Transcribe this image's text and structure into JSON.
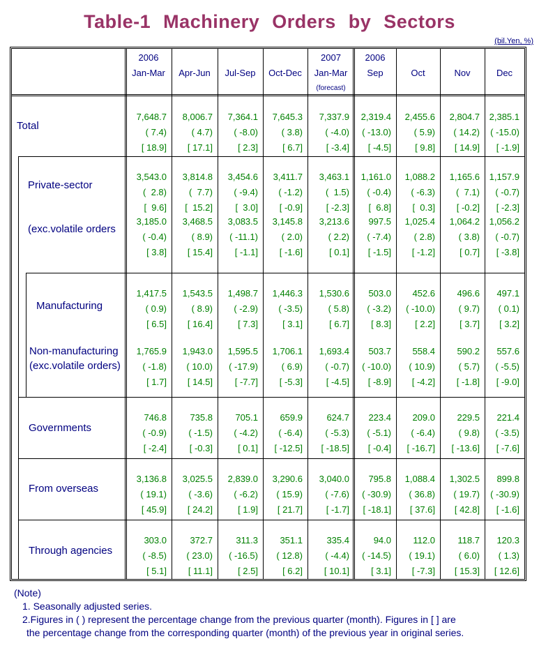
{
  "title": "Table-1  Machinery  Orders  by  Sectors",
  "unit": "(bil.Yen, %)",
  "columns": [
    {
      "line1": "2006",
      "line2": "Jan-Mar",
      "line3": ""
    },
    {
      "line1": "",
      "line2": "Apr-Jun",
      "line3": ""
    },
    {
      "line1": "",
      "line2": "Jul-Sep",
      "line3": ""
    },
    {
      "line1": "",
      "line2": "Oct-Dec",
      "line3": ""
    },
    {
      "line1": "2007",
      "line2": "Jan-Mar",
      "line3": "(forecast)"
    },
    {
      "line1": "2006",
      "line2": "Sep",
      "line3": ""
    },
    {
      "line1": "",
      "line2": "Oct",
      "line3": ""
    },
    {
      "line1": "",
      "line2": "Nov",
      "line3": ""
    },
    {
      "line1": "",
      "line2": "Dec",
      "line3": ""
    }
  ],
  "rows": [
    {
      "label": "Total",
      "values": [
        "7,648.7",
        "8,006.7",
        "7,364.1",
        "7,645.3",
        "7,337.9",
        "2,319.4",
        "2,455.6",
        "2,804.7",
        "2,385.1"
      ],
      "qoq": [
        "( 7.4)",
        "( 4.7)",
        "( -8.0)",
        "( 3.8)",
        "( -4.0)",
        "( -13.0)",
        "( 5.9)",
        "( 14.2)",
        "( -15.0)"
      ],
      "yoy": [
        "[ 18.9]",
        "[ 17.1]",
        "[ 2.3]",
        "[ 6.7]",
        "[ -3.4]",
        "[ -4.5]",
        "[ 9.8]",
        "[ 14.9]",
        "[ -1.9]"
      ]
    },
    {
      "label": "Private-sector",
      "values": [
        "3,543.0",
        "3,814.8",
        "3,454.6",
        "3,411.7",
        "3,463.1",
        "1,161.0",
        "1,088.2",
        "1,165.6",
        "1,157.9"
      ],
      "qoq": [
        "(  2.8)",
        "(  7.7)",
        "( -9.4)",
        "( -1.2)",
        "(  1.5)",
        "( -0.4)",
        "( -6.3)",
        "(  7.1)",
        "( -0.7)"
      ],
      "yoy": [
        "[  9.6]",
        "[  15.2]",
        "[  3.0]",
        "[ -0.9]",
        "[ -2.3]",
        "[  6.8]",
        "[  0.3]",
        "[ -0.2]",
        "[ -2.3]"
      ]
    },
    {
      "label": "(exc.volatile orders",
      "values": [
        "3,185.0",
        "3,468.5",
        "3,083.5",
        "3,145.8",
        "3,213.6",
        "997.5",
        "1,025.4",
        "1,064.2",
        "1,056.2"
      ],
      "qoq": [
        "( -0.4)",
        "( 8.9)",
        "( -11.1)",
        "( 2.0)",
        "( 2.2)",
        "( -7.4)",
        "( 2.8)",
        "( 3.8)",
        "( -0.7)"
      ],
      "yoy": [
        "[ 3.8]",
        "[ 15.4]",
        "[ -1.1]",
        "[ -1.6]",
        "[ 0.1]",
        "[ -1.5]",
        "[ -1.2]",
        "[ 0.7]",
        "[ -3.8]"
      ]
    },
    {
      "label": "Manufacturing",
      "values": [
        "1,417.5",
        "1,543.5",
        "1,498.7",
        "1,446.3",
        "1,530.6",
        "503.0",
        "452.6",
        "496.6",
        "497.1"
      ],
      "qoq": [
        "( 0.9)",
        "( 8.9)",
        "( -2.9)",
        "( -3.5)",
        "( 5.8)",
        "( -3.2)",
        "( -10.0)",
        "( 9.7)",
        "( 0.1)"
      ],
      "yoy": [
        "[ 6.5]",
        "[ 16.4]",
        "[ 7.3]",
        "[ 3.1]",
        "[ 6.7]",
        "[ 8.3]",
        "[ 2.2]",
        "[ 3.7]",
        "[ 3.2]"
      ]
    },
    {
      "label": "Non-manufacturing",
      "label2": "(exc.volatile orders)",
      "values": [
        "1,765.9",
        "1,943.0",
        "1,595.5",
        "1,706.1",
        "1,693.4",
        "503.7",
        "558.4",
        "590.2",
        "557.6"
      ],
      "qoq": [
        "( -1.8)",
        "( 10.0)",
        "( -17.9)",
        "( 6.9)",
        "( -0.7)",
        "( -10.0)",
        "( 10.9)",
        "( 5.7)",
        "( -5.5)"
      ],
      "yoy": [
        "[ 1.7]",
        "[ 14.5]",
        "[ -7.7]",
        "[ -5.3]",
        "[ -4.5]",
        "[ -8.9]",
        "[ -4.2]",
        "[ -1.8]",
        "[ -9.0]"
      ]
    },
    {
      "label": "Governments",
      "values": [
        "746.8",
        "735.8",
        "705.1",
        "659.9",
        "624.7",
        "223.4",
        "209.0",
        "229.5",
        "221.4"
      ],
      "qoq": [
        "( -0.9)",
        "( -1.5)",
        "( -4.2)",
        "( -6.4)",
        "( -5.3)",
        "( -5.1)",
        "( -6.4)",
        "( 9.8)",
        "( -3.5)"
      ],
      "yoy": [
        "[ -2.4]",
        "[ -0.3]",
        "[ 0.1]",
        "[ -12.5]",
        "[ -18.5]",
        "[ -0.4]",
        "[ -16.7]",
        "[ -13.6]",
        "[ -7.6]"
      ]
    },
    {
      "label": "From overseas",
      "values": [
        "3,136.8",
        "3,025.5",
        "2,839.0",
        "3,290.6",
        "3,040.0",
        "795.8",
        "1,088.4",
        "1,302.5",
        "899.8"
      ],
      "qoq": [
        "( 19.1)",
        "( -3.6)",
        "( -6.2)",
        "( 15.9)",
        "( -7.6)",
        "( -30.9)",
        "( 36.8)",
        "( 19.7)",
        "( -30.9)"
      ],
      "yoy": [
        "[ 45.9]",
        "[ 24.2]",
        "[ 1.9]",
        "[ 21.7]",
        "[ -1.7]",
        "[ -18.1]",
        "[ 37.6]",
        "[ 42.8]",
        "[ -1.6]"
      ]
    },
    {
      "label": "Through agencies",
      "values": [
        "303.0",
        "372.7",
        "311.3",
        "351.1",
        "335.4",
        "94.0",
        "112.0",
        "118.7",
        "120.3"
      ],
      "qoq": [
        "( -8.5)",
        "( 23.0)",
        "( -16.5)",
        "( 12.8)",
        "( -4.4)",
        "( -14.5)",
        "( 19.1)",
        "( 6.0)",
        "( 1.3)"
      ],
      "yoy": [
        "[ 5.1]",
        "[ 11.1]",
        "[ 2.5]",
        "[ 6.2]",
        "[ 10.1]",
        "[ 3.1]",
        "[ -7.3]",
        "[ 15.3]",
        "[ 12.6]"
      ]
    }
  ],
  "notes": {
    "heading": "(Note)",
    "items": [
      "1. Seasonally adjusted series.",
      "2.Figures in ( ) represent the percentage change from the previous quarter (month). Figures in [ ] are",
      "the percentage change from the corresponding quarter (month) of the previous year in original series."
    ]
  }
}
